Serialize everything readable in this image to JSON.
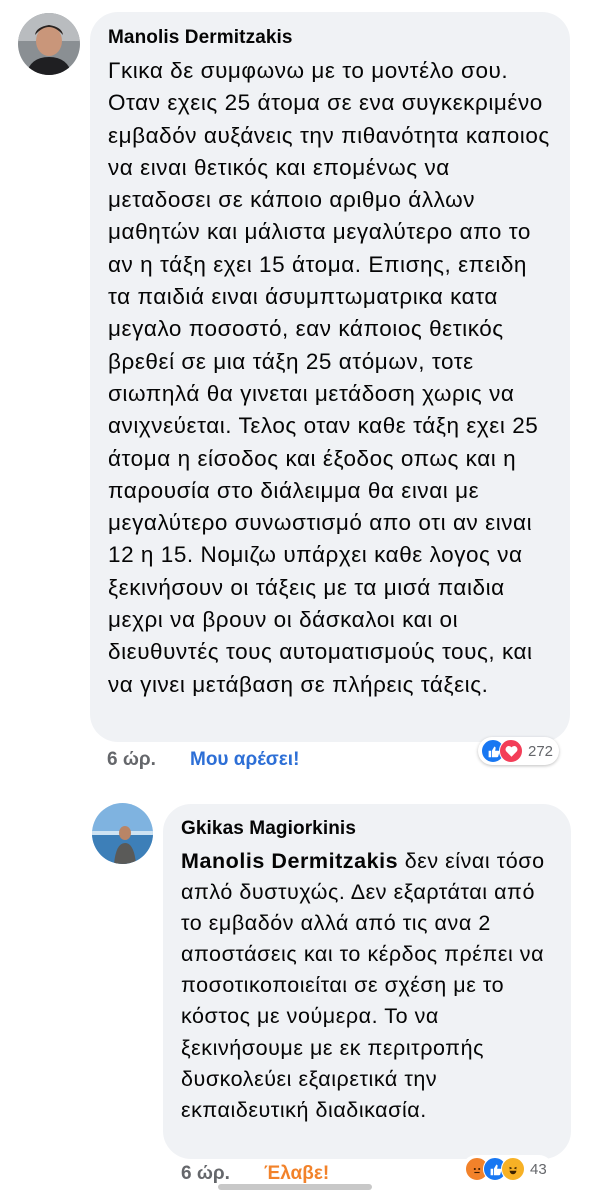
{
  "comments": [
    {
      "author": "Manolis Dermitzakis",
      "avatar_icon": "person-avatar-icon",
      "text": "Γκικα δε συμφωνω με το μοντέλο σου. Οταν εχεις 25 άτομα σε ενα συγκεκριμένο εμβαδόν αυξάνεις την πιθανότητα καποιος να ειναι θετικός και επομένως να μεταδοσει σε κάποιο αριθμο άλλων μαθητών και μάλιστα μεγαλύτερο απο το αν η τάξη εχει 15 άτομα. Επισης, επειδη τα παιδιά ειναι άσυμπτωματρικα κατα μεγαλο ποσοστό, εαν κάποιος θετικός βρεθεί σε μια τάξη 25 ατόμων, τοτε σιωπηλά θα γινεται μετάδοση χωρις να ανιχνεύεται. Τελος οταν καθε τάξη εχει 25 άτομα η είσοδος και έξοδος οπως και η παρουσία στο διάλειμμα θα ειναι με μεγαλύτερο συνωστισμό απο οτι αν ειναι 12 η 15. Νομιζω υπάρχει καθε λογος να ξεκινήσουν οι τάξεις με τα μισά παιδια μεχρι να βρουν οι δάσκαλοι και οι διευθυντές τους αυτοματισμούς τους, και να γινει μετάβαση σε πλήρεις τάξεις.",
      "time": "6 ώρ.",
      "like_label": "Μου αρέσει!",
      "reactions": {
        "icons": [
          "like-reaction-icon",
          "love-reaction-icon"
        ],
        "count": "272"
      }
    },
    {
      "author": "Gkikas Magiorkinis",
      "avatar_icon": "person-avatar-icon",
      "mention": "Manolis Dermitzakis",
      "text": " δεν είναι τόσο απλό δυστυχώς. Δεν εξαρτάται από το εμβαδόν αλλά από τις ανα 2 αποστάσεις και το κέρδος πρέπει να ποσοτικοποιείται σε σχέση με το κόστος με νούμερα. Το να ξεκινήσουμε με εκ περιτροπής δυσκολεύει εξαιρετικά την εκπαιδευτική διαδικασία.",
      "time": "6 ώρ.",
      "like_label": "Έλαβε!",
      "reactions": {
        "icons": [
          "angry-reaction-icon",
          "like-reaction-icon",
          "haha-reaction-icon"
        ],
        "count": "43"
      }
    }
  ],
  "colors": {
    "bubble": "#f0f2f5",
    "meta_gray": "#65676b",
    "like_blue": "#2d6fd6",
    "angry_orange": "#f2822a",
    "love_red": "#f33e58"
  }
}
